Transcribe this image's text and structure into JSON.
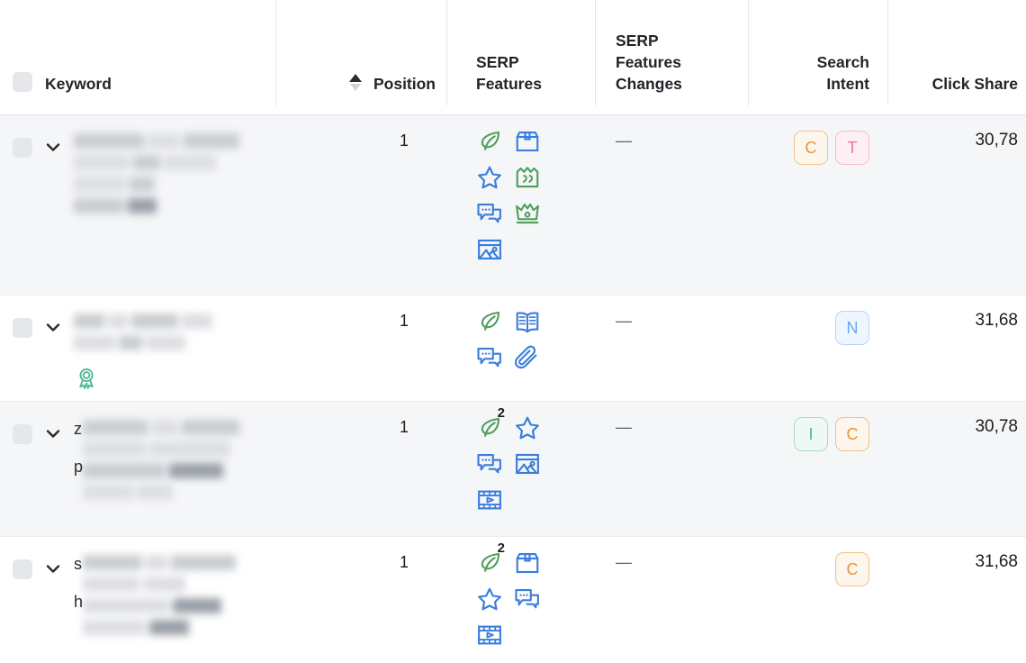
{
  "table": {
    "columns": [
      {
        "key": "keyword",
        "label": "Keyword",
        "lines": [
          "Keyword"
        ]
      },
      {
        "key": "position",
        "label": "Position",
        "lines": [
          "Position"
        ],
        "sortable": true,
        "sort_direction": "asc"
      },
      {
        "key": "serp_features",
        "label": "SERP Features",
        "lines": [
          "SERP",
          "Features"
        ]
      },
      {
        "key": "serp_changes",
        "label": "SERP Features Changes",
        "lines": [
          "SERP",
          "Features",
          "Changes"
        ]
      },
      {
        "key": "search_intent",
        "label": "Search Intent",
        "lines": [
          "Search",
          "Intent"
        ]
      },
      {
        "key": "click_share",
        "label": "Click Share",
        "lines": [
          "Click Share"
        ]
      }
    ],
    "select_all_checkbox": {
      "checked": false
    },
    "rows": [
      {
        "id": "row-1",
        "checkbox": {
          "checked": false
        },
        "expander": "chevron-down",
        "keyword": {
          "redacted": true,
          "visible_prefix": "",
          "text": ""
        },
        "badge_icon": null,
        "position": "1",
        "serp_features": [
          {
            "name": "organic-leaf-icon",
            "color": "green",
            "count": null
          },
          {
            "name": "shopping-box-icon",
            "color": "blue",
            "count": null
          },
          {
            "name": "reviews-star-icon",
            "color": "blue",
            "count": null
          },
          {
            "name": "review-quotes-icon",
            "color": "green",
            "count": null
          },
          {
            "name": "discussions-icon",
            "color": "blue",
            "count": null
          },
          {
            "name": "top-rating-crown-icon",
            "color": "green",
            "count": null
          },
          {
            "name": "image-pack-icon",
            "color": "blue",
            "count": null
          }
        ],
        "serp_changes": "—",
        "search_intent": [
          "C",
          "T"
        ],
        "click_share": "30,78"
      },
      {
        "id": "row-2",
        "checkbox": {
          "checked": false
        },
        "expander": "chevron-down",
        "keyword": {
          "redacted": true,
          "visible_prefix": "",
          "text": ""
        },
        "badge_icon": "award-ribbon-icon",
        "position": "1",
        "serp_features": [
          {
            "name": "organic-leaf-icon",
            "color": "green",
            "count": null
          },
          {
            "name": "open-book-icon",
            "color": "blue",
            "count": null
          },
          {
            "name": "discussions-icon",
            "color": "blue",
            "count": null
          },
          {
            "name": "paperclip-icon",
            "color": "blue",
            "count": null
          }
        ],
        "serp_changes": "—",
        "search_intent": [
          "N"
        ],
        "click_share": "31,68"
      },
      {
        "id": "row-3",
        "checkbox": {
          "checked": false
        },
        "expander": "chevron-down",
        "keyword": {
          "redacted": true,
          "visible_prefix": "z",
          "visible_prefix_2": "p",
          "text": ""
        },
        "badge_icon": null,
        "position": "1",
        "serp_features": [
          {
            "name": "organic-leaf-icon",
            "color": "green",
            "count": "2"
          },
          {
            "name": "reviews-star-icon",
            "color": "blue",
            "count": null
          },
          {
            "name": "discussions-icon",
            "color": "blue",
            "count": null
          },
          {
            "name": "image-pack-icon",
            "color": "blue",
            "count": null
          },
          {
            "name": "video-icon",
            "color": "blue",
            "count": null
          }
        ],
        "serp_changes": "—",
        "search_intent": [
          "I",
          "C"
        ],
        "click_share": "30,78"
      },
      {
        "id": "row-4",
        "checkbox": {
          "checked": false
        },
        "expander": "chevron-down",
        "keyword": {
          "redacted": true,
          "visible_prefix": "s",
          "visible_prefix_2": "h",
          "text": ""
        },
        "badge_icon": null,
        "position": "1",
        "serp_features": [
          {
            "name": "organic-leaf-icon",
            "color": "green",
            "count": "2"
          },
          {
            "name": "shopping-box-icon",
            "color": "blue",
            "count": null
          },
          {
            "name": "reviews-star-icon",
            "color": "blue",
            "count": null
          },
          {
            "name": "discussions-icon",
            "color": "blue",
            "count": null
          },
          {
            "name": "video-icon",
            "color": "blue",
            "count": null
          }
        ],
        "serp_changes": "—",
        "search_intent": [
          "C"
        ],
        "click_share": "31,68"
      }
    ]
  },
  "colors": {
    "green_icon": "#4f9e5c",
    "blue_icon": "#3b7ddd",
    "row_shaded": "#f5f6f8",
    "row_plain": "#ffffff",
    "border": "#e3e6eb",
    "text": "#1c1c1c",
    "intent_commercial": "#e8962f",
    "intent_transactional": "#e8799b",
    "intent_navigational": "#6aa8f0",
    "intent_informational": "#4db897"
  }
}
